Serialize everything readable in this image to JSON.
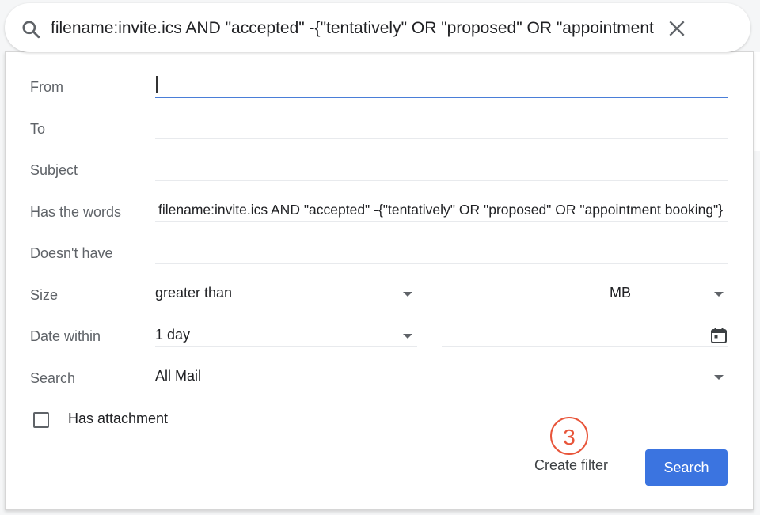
{
  "searchbar": {
    "query": "filename:invite.ics AND \"accepted\" -{\"tentatively\" OR \"proposed\" OR \"appointment booking\"}",
    "search_icon": "search-icon",
    "clear_icon": "close-icon"
  },
  "form": {
    "from": {
      "label": "From",
      "value": ""
    },
    "to": {
      "label": "To",
      "value": ""
    },
    "subject": {
      "label": "Subject",
      "value": ""
    },
    "has_words": {
      "label": "Has the words",
      "value": "filename:invite.ics AND \"accepted\" -{\"tentatively\" OR \"proposed\" OR \"appointment booking\"}"
    },
    "doesnt_have": {
      "label": "Doesn't have",
      "value": ""
    },
    "size": {
      "label": "Size",
      "comparator": "greater than",
      "value": "",
      "unit": "MB"
    },
    "date_within": {
      "label": "Date within",
      "range": "1 day",
      "date": "",
      "calendar_icon": "calendar-icon"
    },
    "search_in": {
      "label": "Search",
      "value": "All Mail"
    },
    "has_attachment": {
      "label": "Has attachment",
      "checked": false
    }
  },
  "annotation": {
    "step": "3",
    "color": "#e8553a"
  },
  "actions": {
    "create_filter": "Create filter",
    "search": "Search",
    "search_color": "#3b74e0"
  }
}
